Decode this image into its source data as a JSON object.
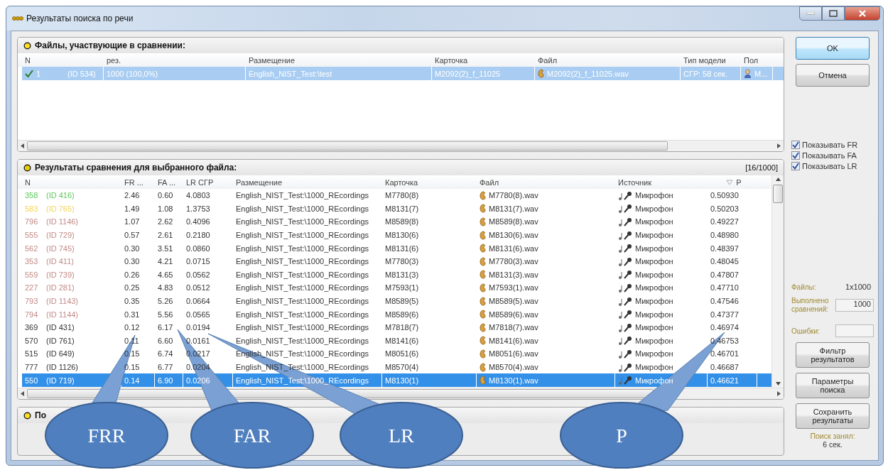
{
  "window": {
    "title": "Результаты поиска по речи"
  },
  "files_panel": {
    "title": "Файлы, участвующие в сравнении:",
    "columns": [
      "N",
      "рез.",
      "Размещение",
      "Карточка",
      "Файл",
      "Тип модели",
      "Пол"
    ],
    "rows": [
      {
        "n": "1",
        "id": "(ID 534)",
        "result": "1000 (100,0%)",
        "location": "English_NIST_Test:\\test",
        "card": "M2092(2)_f_11025",
        "file": "M2092(2)_f_11025.wav",
        "model_type": "СГР: 58 сек.",
        "sex": "М...",
        "checked": true,
        "selected": true
      }
    ]
  },
  "results_panel": {
    "title": "Результаты сравнения для выбранного файла:",
    "count": "[16/1000]",
    "columns": [
      "N",
      "FR ...",
      "FA ...",
      "LR СГР",
      "Размещение",
      "Карточка",
      "Файл",
      "Источник",
      "P"
    ],
    "rows": [
      {
        "n": "358",
        "id": "(ID 416)",
        "color": "#5cc85c",
        "fr": "2.46",
        "fa": "0.60",
        "lr": "4.0803",
        "location": "English_NIST_Test:\\1000_REcordings",
        "card": "M7780(8)",
        "file": "M7780(8).wav",
        "source": "Микрофон",
        "p": "0.50930",
        "selected": false
      },
      {
        "n": "583",
        "id": "(ID 765)",
        "color": "#f2d35a",
        "fr": "1.49",
        "fa": "1.08",
        "lr": "1.3753",
        "location": "English_NIST_Test:\\1000_REcordings",
        "card": "M8131(7)",
        "file": "M8131(7).wav",
        "source": "Микрофон",
        "p": "0.50203",
        "selected": false
      },
      {
        "n": "796",
        "id": "(ID 1146)",
        "color": "#c08a86",
        "fr": "1.07",
        "fa": "2.62",
        "lr": "0.4096",
        "location": "English_NIST_Test:\\1000_REcordings",
        "card": "M8589(8)",
        "file": "M8589(8).wav",
        "source": "Микрофон",
        "p": "0.49227",
        "selected": false
      },
      {
        "n": "555",
        "id": "(ID 729)",
        "color": "#c08a86",
        "fr": "0.57",
        "fa": "2.61",
        "lr": "0.2180",
        "location": "English_NIST_Test:\\1000_REcordings",
        "card": "M8130(6)",
        "file": "M8130(6).wav",
        "source": "Микрофон",
        "p": "0.48980",
        "selected": false
      },
      {
        "n": "562",
        "id": "(ID 745)",
        "color": "#c08a86",
        "fr": "0.30",
        "fa": "3.51",
        "lr": "0.0860",
        "location": "English_NIST_Test:\\1000_REcordings",
        "card": "M8131(6)",
        "file": "M8131(6).wav",
        "source": "Микрофон",
        "p": "0.48397",
        "selected": false
      },
      {
        "n": "353",
        "id": "(ID 411)",
        "color": "#c08a86",
        "fr": "0.30",
        "fa": "4.21",
        "lr": "0.0715",
        "location": "English_NIST_Test:\\1000_REcordings",
        "card": "M7780(3)",
        "file": "M7780(3).wav",
        "source": "Микрофон",
        "p": "0.48045",
        "selected": false
      },
      {
        "n": "559",
        "id": "(ID 739)",
        "color": "#c08a86",
        "fr": "0.26",
        "fa": "4.65",
        "lr": "0.0562",
        "location": "English_NIST_Test:\\1000_REcordings",
        "card": "M8131(3)",
        "file": "M8131(3).wav",
        "source": "Микрофон",
        "p": "0.47807",
        "selected": false
      },
      {
        "n": "227",
        "id": "(ID 281)",
        "color": "#c08a86",
        "fr": "0.25",
        "fa": "4.83",
        "lr": "0.0512",
        "location": "English_NIST_Test:\\1000_REcordings",
        "card": "M7593(1)",
        "file": "M7593(1).wav",
        "source": "Микрофон",
        "p": "0.47710",
        "selected": false
      },
      {
        "n": "793",
        "id": "(ID 1143)",
        "color": "#c08a86",
        "fr": "0.35",
        "fa": "5.26",
        "lr": "0.0664",
        "location": "English_NIST_Test:\\1000_REcordings",
        "card": "M8589(5)",
        "file": "M8589(5).wav",
        "source": "Микрофон",
        "p": "0.47546",
        "selected": false
      },
      {
        "n": "794",
        "id": "(ID 1144)",
        "color": "#c08a86",
        "fr": "0.31",
        "fa": "5.56",
        "lr": "0.0565",
        "location": "English_NIST_Test:\\1000_REcordings",
        "card": "M8589(6)",
        "file": "M8589(6).wav",
        "source": "Микрофон",
        "p": "0.47377",
        "selected": false
      },
      {
        "n": "369",
        "id": "(ID 431)",
        "color": "#333333",
        "fr": "0.12",
        "fa": "6.17",
        "lr": "0.0194",
        "location": "English_NIST_Test:\\1000_REcordings",
        "card": "M7818(7)",
        "file": "M7818(7).wav",
        "source": "Микрофон",
        "p": "0.46974",
        "selected": false
      },
      {
        "n": "570",
        "id": "(ID 761)",
        "color": "#333333",
        "fr": "0.11",
        "fa": "6.60",
        "lr": "0.0161",
        "location": "English_NIST_Test:\\1000_REcordings",
        "card": "M8141(6)",
        "file": "M8141(6).wav",
        "source": "Микрофон",
        "p": "0.46753",
        "selected": false
      },
      {
        "n": "515",
        "id": "(ID 649)",
        "color": "#333333",
        "fr": "0.15",
        "fa": "6.74",
        "lr": "0.0217",
        "location": "English_NIST_Test:\\1000_REcordings",
        "card": "M8051(6)",
        "file": "M8051(6).wav",
        "source": "Микрофон",
        "p": "0.46701",
        "selected": false
      },
      {
        "n": "777",
        "id": "(ID 1126)",
        "color": "#333333",
        "fr": "0.15",
        "fa": "6.77",
        "lr": "0.0204",
        "location": "English_NIST_Test:\\1000_REcordings",
        "card": "M8570(4)",
        "file": "M8570(4).wav",
        "source": "Микрофон",
        "p": "0.46687",
        "selected": false
      },
      {
        "n": "550",
        "id": "(ID 719)",
        "color": "#ffffff",
        "fr": "0.14",
        "fa": "6.90",
        "lr": "0.0206",
        "location": "English_NIST_Test:\\1000_REcordings",
        "card": "M8130(1)",
        "file": "M8130(1).wav",
        "source": "Микрофон",
        "p": "0.46621",
        "selected": true
      }
    ]
  },
  "bottom_panel": {
    "title": "По"
  },
  "dialog_buttons": [
    {
      "label": "OK",
      "kind": "default"
    },
    {
      "label": "Отмена",
      "kind": "normal"
    }
  ],
  "options": [
    {
      "label": "Показывать FR",
      "checked": true
    },
    {
      "label": "Показывать FA",
      "checked": true
    },
    {
      "label": "Показывать LR",
      "checked": true
    }
  ],
  "stats": {
    "files_label": "Файлы:",
    "files_value": "1x1000",
    "done_label": "Выполнено сравнений:",
    "done_value": "1000",
    "errors_label": "Ошибки:"
  },
  "action_buttons": [
    "Фильтр результатов",
    "Параметры поиска",
    "Сохранить результаты"
  ],
  "elapsed": {
    "label": "Поиск занял:",
    "value": "6 сек."
  },
  "callouts": [
    {
      "label": "FRR"
    },
    {
      "label": "FAR"
    },
    {
      "label": "LR"
    },
    {
      "label": "P"
    }
  ]
}
